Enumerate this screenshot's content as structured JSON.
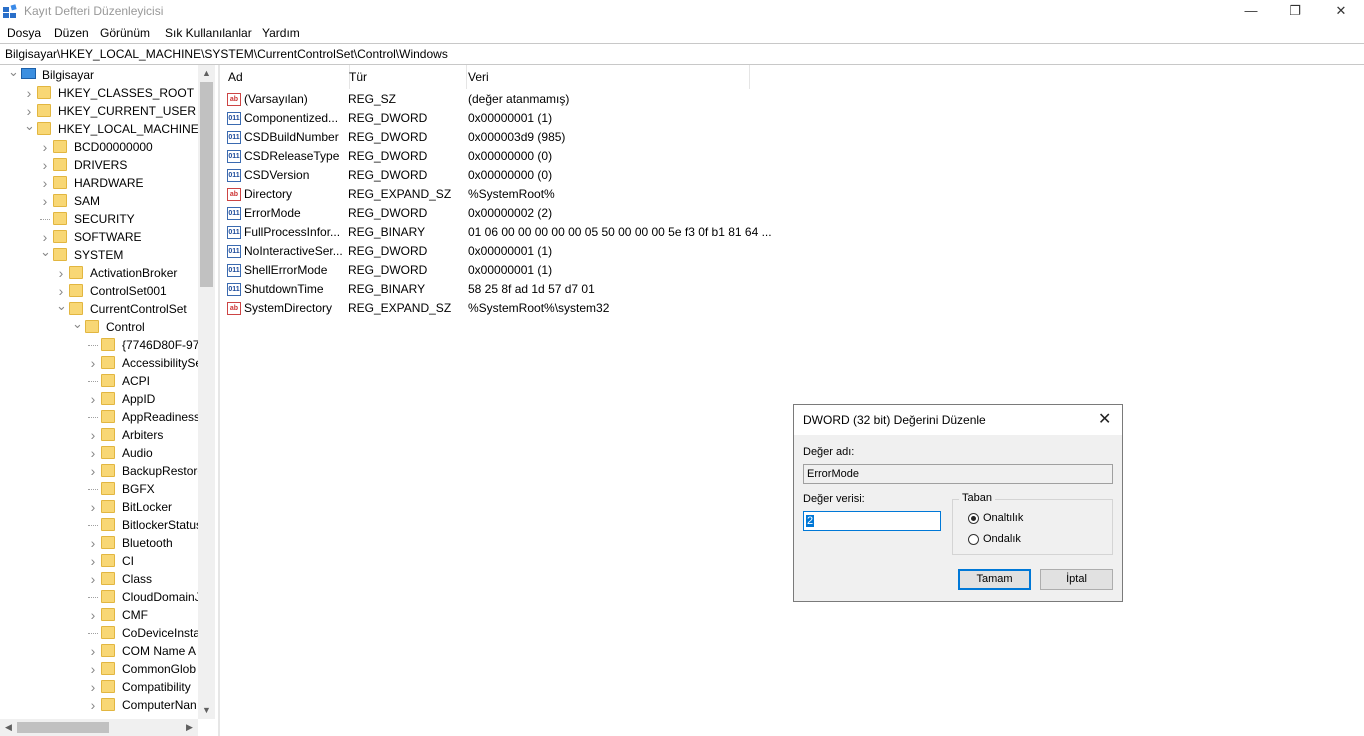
{
  "window": {
    "title": "Kayıt Defteri Düzenleyicisi"
  },
  "menu": [
    "Dosya",
    "Düzen",
    "Görünüm",
    "Sık Kullanılanlar",
    "Yardım"
  ],
  "address": "Bilgisayar\\HKEY_LOCAL_MACHINE\\SYSTEM\\CurrentControlSet\\Control\\Windows",
  "tree": [
    {
      "label": "Bilgisayar",
      "expander": "open"
    },
    {
      "label": "HKEY_CLASSES_ROOT",
      "expander": "closed"
    },
    {
      "label": "HKEY_CURRENT_USER",
      "expander": "closed"
    },
    {
      "label": "HKEY_LOCAL_MACHINE",
      "expander": "open"
    },
    {
      "label": "BCD00000000",
      "expander": "closed"
    },
    {
      "label": "DRIVERS",
      "expander": "closed"
    },
    {
      "label": "HARDWARE",
      "expander": "closed"
    },
    {
      "label": "SAM",
      "expander": "closed"
    },
    {
      "label": "SECURITY",
      "expander": "none"
    },
    {
      "label": "SOFTWARE",
      "expander": "closed"
    },
    {
      "label": "SYSTEM",
      "expander": "open"
    },
    {
      "label": "ActivationBroker",
      "expander": "closed"
    },
    {
      "label": "ControlSet001",
      "expander": "closed"
    },
    {
      "label": "CurrentControlSet",
      "expander": "open"
    },
    {
      "label": "Control",
      "expander": "open"
    },
    {
      "label": "{7746D80F-97E",
      "expander": "none"
    },
    {
      "label": "AccessibilitySe",
      "expander": "closed"
    },
    {
      "label": "ACPI",
      "expander": "none"
    },
    {
      "label": "AppID",
      "expander": "closed"
    },
    {
      "label": "AppReadiness",
      "expander": "none"
    },
    {
      "label": "Arbiters",
      "expander": "closed"
    },
    {
      "label": "Audio",
      "expander": "closed"
    },
    {
      "label": "BackupRestore",
      "expander": "closed"
    },
    {
      "label": "BGFX",
      "expander": "none"
    },
    {
      "label": "BitLocker",
      "expander": "closed"
    },
    {
      "label": "BitlockerStatus",
      "expander": "none"
    },
    {
      "label": "Bluetooth",
      "expander": "closed"
    },
    {
      "label": "CI",
      "expander": "closed"
    },
    {
      "label": "Class",
      "expander": "closed"
    },
    {
      "label": "CloudDomainJ",
      "expander": "none"
    },
    {
      "label": "CMF",
      "expander": "closed"
    },
    {
      "label": "CoDeviceInsta",
      "expander": "none"
    },
    {
      "label": "COM Name A",
      "expander": "closed"
    },
    {
      "label": "CommonGlob",
      "expander": "closed"
    },
    {
      "label": "Compatibility",
      "expander": "closed"
    },
    {
      "label": "ComputerNan",
      "expander": "closed"
    }
  ],
  "list": {
    "headers": {
      "name": "Ad",
      "type": "Tür",
      "data": "Veri"
    },
    "rows": [
      {
        "icon": "string",
        "name": "(Varsayılan)",
        "type": "REG_SZ",
        "data": "(değer atanmamış)"
      },
      {
        "icon": "binary",
        "name": "Componentized...",
        "type": "REG_DWORD",
        "data": "0x00000001 (1)"
      },
      {
        "icon": "binary",
        "name": "CSDBuildNumber",
        "type": "REG_DWORD",
        "data": "0x000003d9 (985)"
      },
      {
        "icon": "binary",
        "name": "CSDReleaseType",
        "type": "REG_DWORD",
        "data": "0x00000000 (0)"
      },
      {
        "icon": "binary",
        "name": "CSDVersion",
        "type": "REG_DWORD",
        "data": "0x00000000 (0)"
      },
      {
        "icon": "string",
        "name": "Directory",
        "type": "REG_EXPAND_SZ",
        "data": "%SystemRoot%"
      },
      {
        "icon": "binary",
        "name": "ErrorMode",
        "type": "REG_DWORD",
        "data": "0x00000002 (2)"
      },
      {
        "icon": "binary",
        "name": "FullProcessInfor...",
        "type": "REG_BINARY",
        "data": "01 06 00 00 00 00 00 05 50 00 00 00 5e f3 0f b1 81 64 ..."
      },
      {
        "icon": "binary",
        "name": "NoInteractiveSer...",
        "type": "REG_DWORD",
        "data": "0x00000001 (1)"
      },
      {
        "icon": "binary",
        "name": "ShellErrorMode",
        "type": "REG_DWORD",
        "data": "0x00000001 (1)"
      },
      {
        "icon": "binary",
        "name": "ShutdownTime",
        "type": "REG_BINARY",
        "data": "58 25 8f ad 1d 57 d7 01"
      },
      {
        "icon": "string",
        "name": "SystemDirectory",
        "type": "REG_EXPAND_SZ",
        "data": "%SystemRoot%\\system32"
      }
    ]
  },
  "dialog": {
    "title": "DWORD (32 bit) Değerini Düzenle",
    "name_label": "Değer adı:",
    "name_value": "ErrorMode",
    "data_label": "Değer verisi:",
    "data_value": "2",
    "base_label": "Taban",
    "base_hex": "Onaltılık",
    "base_dec": "Ondalık",
    "base_selected": "hex",
    "ok": "Tamam",
    "cancel": "İptal"
  }
}
